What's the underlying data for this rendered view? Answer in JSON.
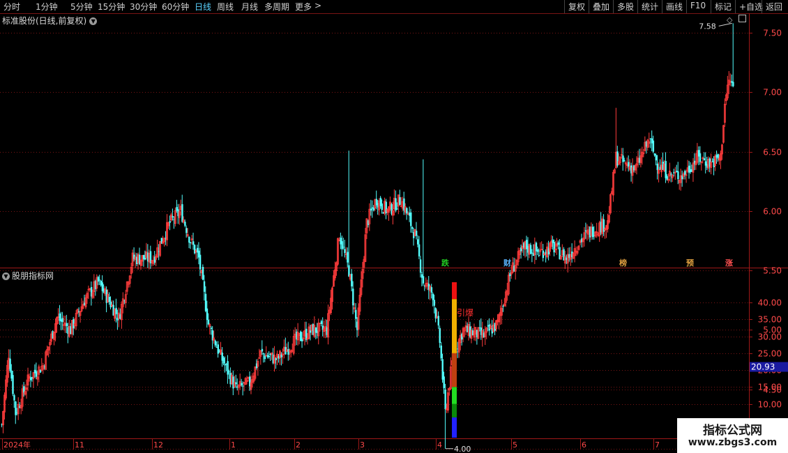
{
  "toolbar": {
    "periods": [
      "分时",
      "1分钟",
      "5分钟",
      "15分钟",
      "30分钟",
      "60分钟",
      "日线",
      "周线",
      "月线",
      "多周期",
      "更多"
    ],
    "active": "日线",
    "more_arrow": ">",
    "right_buttons": [
      "复权",
      "叠加",
      "多股",
      "统计",
      "画线",
      "F10",
      "标记",
      "+自选",
      "返回"
    ]
  },
  "main_title": "标准股份(日线,前复权)",
  "main_title_icon": "chevron-down-icon",
  "indicator_title": "股朋指标网",
  "indicator_title_icon": "chevron-down-icon",
  "corner_icons": [
    "diamond-icon",
    "panel-toggle-icon"
  ],
  "price_axis": [
    "7.50",
    "7.00",
    "6.50",
    "6.00",
    "5.50",
    "5.00",
    "4.50",
    "4.00"
  ],
  "indicator_axis": [
    "40.00",
    "35.00",
    "30.00",
    "25.00",
    "20.00",
    "15.00",
    "10.00"
  ],
  "indicator_current": "20.93",
  "high_label": "7.58",
  "low_label": "4.00",
  "event_markers": [
    {
      "text": "跌",
      "color": "#22cc22"
    },
    {
      "text": "财",
      "color": "#5ab4ff"
    },
    {
      "text": "榜",
      "color": "#e0a040"
    },
    {
      "text": "预",
      "color": "#e0a040"
    },
    {
      "text": "涨",
      "color": "#ff5050"
    }
  ],
  "signal_label": "引爆",
  "time_axis": [
    "2024年",
    "11",
    "12",
    "1",
    "2",
    "3",
    "4",
    "5",
    "6",
    "7"
  ],
  "watermark": {
    "line1": "指标公式网",
    "line2": "www.zbgs3.com"
  },
  "chart_data": {
    "type": "candlestick",
    "title": "标准股份(日线,前复权)",
    "price_range": [
      3.6,
      7.75
    ],
    "high": 7.58,
    "low": 4.0,
    "months": [
      "2024年",
      "11",
      "12",
      "1",
      "2",
      "3",
      "4",
      "5",
      "6",
      "7"
    ],
    "close_path": [
      [
        0,
        4.2
      ],
      [
        5,
        4.8
      ],
      [
        10,
        4.3
      ],
      [
        20,
        4.6
      ],
      [
        30,
        4.7
      ],
      [
        40,
        5.1
      ],
      [
        50,
        5.0
      ],
      [
        60,
        5.25
      ],
      [
        70,
        5.4
      ],
      [
        85,
        5.1
      ],
      [
        95,
        5.6
      ],
      [
        110,
        5.6
      ],
      [
        122,
        5.9
      ],
      [
        130,
        6.0
      ],
      [
        137,
        5.75
      ],
      [
        143,
        5.6
      ],
      [
        150,
        5.05
      ],
      [
        158,
        4.8
      ],
      [
        170,
        4.5
      ],
      [
        180,
        4.55
      ],
      [
        188,
        4.8
      ],
      [
        200,
        4.75
      ],
      [
        212,
        4.9
      ],
      [
        226,
        5.0
      ],
      [
        236,
        5.0
      ],
      [
        245,
        5.8
      ],
      [
        252,
        5.5
      ],
      [
        258,
        5.0
      ],
      [
        265,
        5.9
      ],
      [
        272,
        6.1
      ],
      [
        280,
        6.0
      ],
      [
        290,
        6.1
      ],
      [
        300,
        5.8
      ],
      [
        306,
        5.4
      ],
      [
        313,
        5.3
      ],
      [
        318,
        4.9
      ],
      [
        322,
        4.3
      ],
      [
        328,
        4.8
      ],
      [
        335,
        5.0
      ],
      [
        350,
        4.95
      ],
      [
        360,
        5.05
      ],
      [
        370,
        5.5
      ],
      [
        380,
        5.7
      ],
      [
        390,
        5.65
      ],
      [
        400,
        5.7
      ],
      [
        410,
        5.6
      ],
      [
        420,
        5.75
      ],
      [
        430,
        5.85
      ],
      [
        440,
        5.9
      ],
      [
        446,
        6.45
      ],
      [
        452,
        6.4
      ],
      [
        460,
        6.35
      ],
      [
        470,
        6.6
      ],
      [
        476,
        6.4
      ],
      [
        485,
        6.3
      ],
      [
        495,
        6.3
      ],
      [
        505,
        6.45
      ],
      [
        515,
        6.4
      ],
      [
        522,
        6.45
      ],
      [
        525,
        6.9
      ],
      [
        528,
        7.1
      ],
      [
        531,
        7.05
      ]
    ],
    "indicator": {
      "type": "bar",
      "name": "股朋指标网",
      "segments": [
        {
          "from": 0,
          "to": 6,
          "color": "#2222ff"
        },
        {
          "from": 6,
          "to": 10,
          "color": "#0a8a0a"
        },
        {
          "from": 10,
          "to": 15,
          "color": "#22dd22"
        },
        {
          "from": 15,
          "to": 25,
          "color": "#c04010"
        },
        {
          "from": 25,
          "to": 41,
          "color": "#f0b000"
        },
        {
          "from": 41,
          "to": 46,
          "color": "#ee1111"
        }
      ],
      "current": 20.93
    }
  }
}
